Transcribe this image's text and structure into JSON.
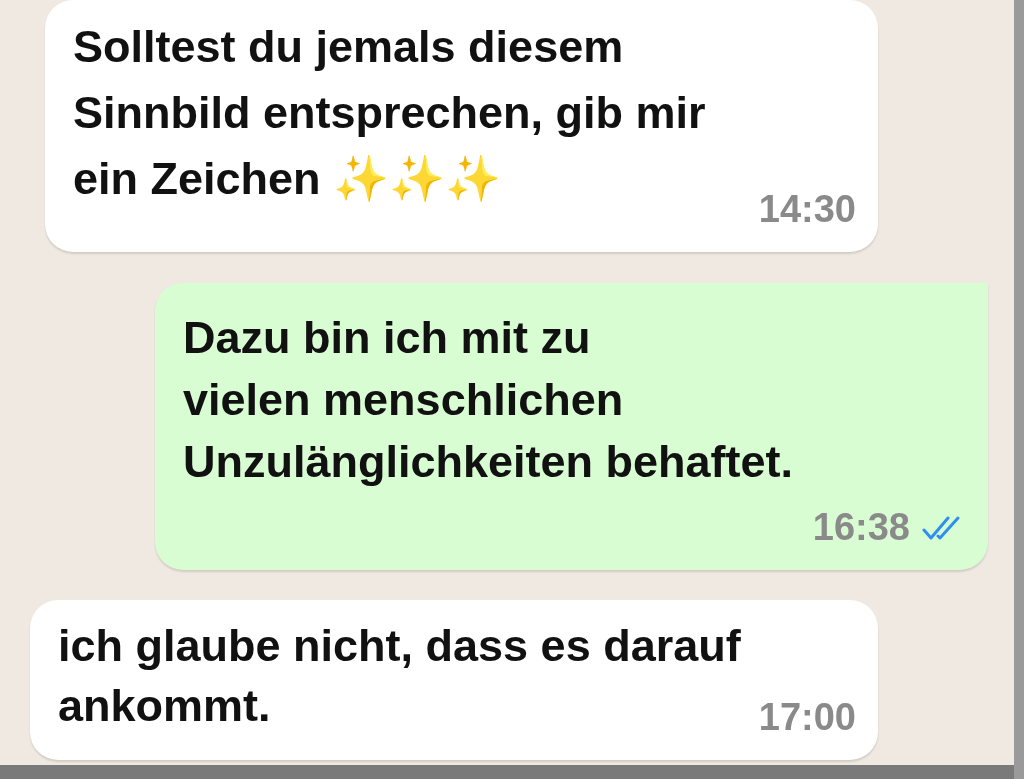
{
  "messages": [
    {
      "kind": "incoming",
      "text": "Solltest du jemals diesem\nSinnbild entsprechen, gib mir\nein Zeichen ✨✨✨",
      "time": "14:30"
    },
    {
      "kind": "outgoing",
      "text": "Dazu bin ich mit zu\nvielen menschlichen\nUnzulänglichkeiten behaftet.",
      "time": "16:38",
      "read": true
    },
    {
      "kind": "incoming",
      "text": "ich glaube nicht, dass es darauf\nankommt.",
      "time": "17:00"
    }
  ]
}
